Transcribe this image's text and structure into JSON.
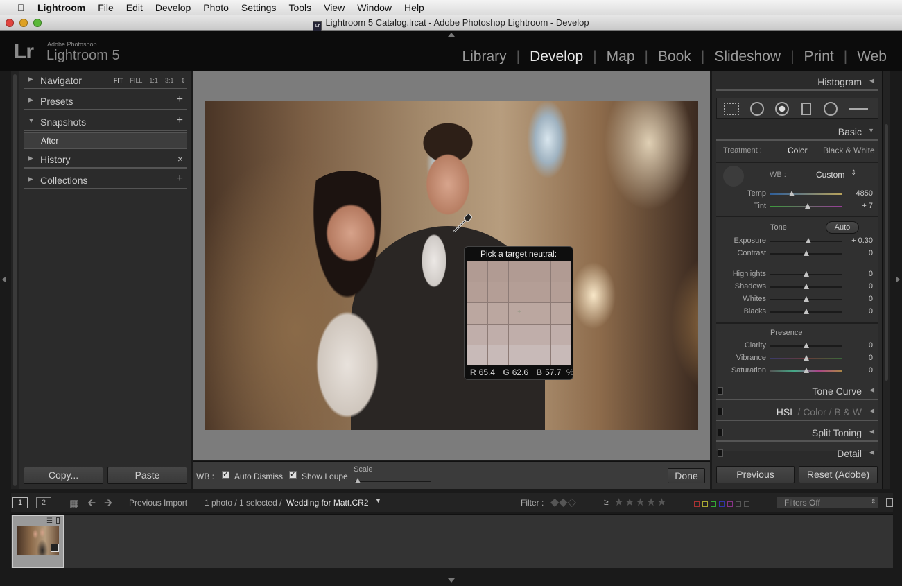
{
  "menubar": {
    "app": "Lightroom",
    "items": [
      "File",
      "Edit",
      "Develop",
      "Photo",
      "Settings",
      "Tools",
      "View",
      "Window",
      "Help"
    ]
  },
  "window": {
    "title": "Lightroom 5 Catalog.lrcat - Adobe Photoshop Lightroom - Develop"
  },
  "identity": {
    "lr": "Lr",
    "adobe": "Adobe Photoshop",
    "product": "Lightroom 5"
  },
  "modules": [
    {
      "label": "Library",
      "active": false
    },
    {
      "label": "Develop",
      "active": true
    },
    {
      "label": "Map",
      "active": false
    },
    {
      "label": "Book",
      "active": false
    },
    {
      "label": "Slideshow",
      "active": false
    },
    {
      "label": "Print",
      "active": false
    },
    {
      "label": "Web",
      "active": false
    }
  ],
  "left": {
    "navigator": {
      "label": "Navigator",
      "opts": [
        "FIT",
        "FILL",
        "1:1",
        "3:1"
      ]
    },
    "presets": "Presets",
    "snapshots": {
      "label": "Snapshots",
      "item": "After"
    },
    "history": "History",
    "collections": "Collections",
    "copy": "Copy...",
    "paste": "Paste"
  },
  "loupe": {
    "title": "Pick a target neutral:",
    "r_label": "R",
    "r": "65.4",
    "g_label": "G",
    "g": "62.6",
    "b_label": "B",
    "b": "57.7",
    "unit": "%"
  },
  "toolbar": {
    "wb": "WB :",
    "auto_dismiss": "Auto Dismiss",
    "show_loupe": "Show Loupe",
    "scale": "Scale",
    "done": "Done"
  },
  "right": {
    "histogram": "Histogram",
    "basic": "Basic",
    "treatment": "Treatment :",
    "color": "Color",
    "bw": "Black & White",
    "wb_label": "WB :",
    "wb_value": "Custom",
    "tone_label": "Tone",
    "auto": "Auto",
    "presence_label": "Presence",
    "sliders_wb": [
      {
        "label": "Temp",
        "value": "4850",
        "pos": 0.3
      },
      {
        "label": "Tint",
        "value": "+ 7",
        "pos": 0.52
      }
    ],
    "sliders_tone1": [
      {
        "label": "Exposure",
        "value": "+ 0.30",
        "pos": 0.53
      },
      {
        "label": "Contrast",
        "value": "0",
        "pos": 0.5
      }
    ],
    "sliders_tone2": [
      {
        "label": "Highlights",
        "value": "0",
        "pos": 0.5
      },
      {
        "label": "Shadows",
        "value": "0",
        "pos": 0.5
      },
      {
        "label": "Whites",
        "value": "0",
        "pos": 0.5
      },
      {
        "label": "Blacks",
        "value": "0",
        "pos": 0.5
      }
    ],
    "sliders_presence": [
      {
        "label": "Clarity",
        "value": "0",
        "pos": 0.5
      },
      {
        "label": "Vibrance",
        "value": "0",
        "pos": 0.5
      },
      {
        "label": "Saturation",
        "value": "0",
        "pos": 0.5
      }
    ],
    "tone_curve": "Tone Curve",
    "hsl": "HSL",
    "hsl_color": "Color",
    "hsl_bw": "B & W",
    "split_toning": "Split Toning",
    "detail": "Detail",
    "previous": "Previous",
    "reset": "Reset (Adobe)"
  },
  "filmstrip": {
    "page1": "1",
    "page2": "2",
    "source": "Previous Import",
    "count": "1 photo / 1 selected /",
    "filename": "Wedding for Matt.CR2",
    "filter_label": "Filter :",
    "ge": "≥",
    "filters_off": "Filters Off"
  }
}
